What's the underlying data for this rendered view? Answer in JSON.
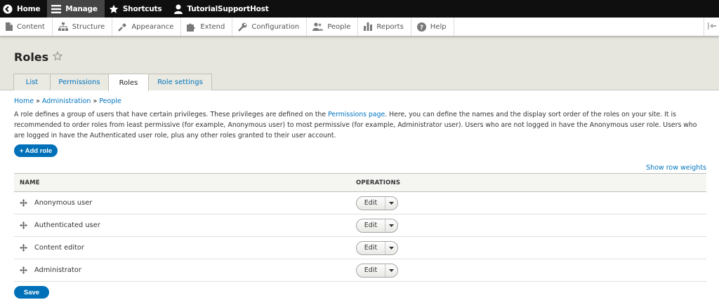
{
  "toolbar": {
    "home": "Home",
    "manage": "Manage",
    "shortcuts": "Shortcuts",
    "user": "TutorialSupportHost"
  },
  "tray": {
    "content": "Content",
    "structure": "Structure",
    "appearance": "Appearance",
    "extend": "Extend",
    "configuration": "Configuration",
    "people": "People",
    "reports": "Reports",
    "help": "Help"
  },
  "page": {
    "title": "Roles"
  },
  "tabs": {
    "list": "List",
    "permissions": "Permissions",
    "roles": "Roles",
    "role_settings": "Role settings"
  },
  "breadcrumb": {
    "home": "Home",
    "sep1": " » ",
    "administration": "Administration",
    "sep2": " » ",
    "people": "People"
  },
  "description": {
    "part1": "A role defines a group of users that have certain privileges. These privileges are defined on the ",
    "link": "Permissions page",
    "part2": ". Here, you can define the names and the display sort order of the roles on your site. It is recommended to order roles from least permissive (for example, Anonymous user) to most permissive (for example, Administrator user). Users who are not logged in have the Anonymous user role. Users who are logged in have the Authenticated user role, plus any other roles granted to their user account."
  },
  "actions": {
    "add_role": "+ Add role",
    "show_weights": "Show row weights",
    "save": "Save"
  },
  "table": {
    "headers": {
      "name": "NAME",
      "operations": "OPERATIONS"
    },
    "rows": [
      {
        "name": "Anonymous user",
        "edit": "Edit"
      },
      {
        "name": "Authenticated user",
        "edit": "Edit"
      },
      {
        "name": "Content editor",
        "edit": "Edit"
      },
      {
        "name": "Administrator",
        "edit": "Edit"
      }
    ]
  },
  "colors": {
    "link": "#0074bd",
    "primary_button": "#0071b8",
    "toolbar": "#0f0f0f",
    "header_bg": "#e6e5de"
  }
}
